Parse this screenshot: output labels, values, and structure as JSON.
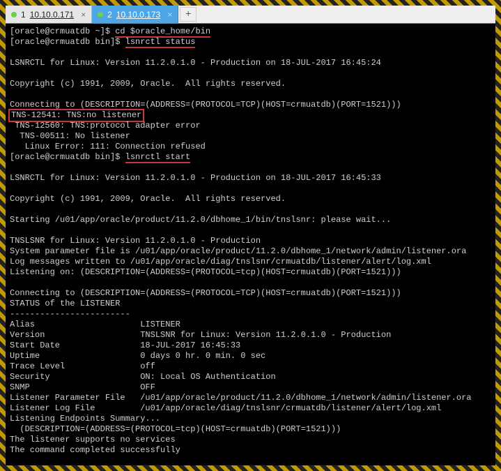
{
  "tabs": {
    "items": [
      {
        "index": "1",
        "label": "10.10.0.171",
        "close": "×"
      },
      {
        "index": "2",
        "label": "10.10.0.173",
        "close": "×"
      }
    ],
    "active": 1,
    "add": "+"
  },
  "terminal": {
    "line01_prompt": "[oracle@crmuatdb ~]$ ",
    "line01_cmd": "cd $oracle_home/bin",
    "line02_prompt": "[oracle@crmuatdb bin]$ ",
    "line02_cmd": "lsnrctl status",
    "blank": "",
    "line04": "LSNRCTL for Linux: Version 11.2.0.1.0 - Production on 18-JUL-2017 16:45:24",
    "line06": "Copyright (c) 1991, 2009, Oracle.  All rights reserved.",
    "line08": "Connecting to (DESCRIPTION=(ADDRESS=(PROTOCOL=TCP)(HOST=crmuatdb)(PORT=1521)))",
    "line09": "TNS-12541: TNS:no listener",
    "line10": " TNS-12560: TNS:protocol adapter error",
    "line11": "  TNS-00511: No listener",
    "line12": "   Linux Error: 111: Connection refused",
    "line13_prompt": "[oracle@crmuatdb bin]$ ",
    "line13_cmd": "lsnrctl start",
    "line15": "LSNRCTL for Linux: Version 11.2.0.1.0 - Production on 18-JUL-2017 16:45:33",
    "line17": "Copyright (c) 1991, 2009, Oracle.  All rights reserved.",
    "line19": "Starting /u01/app/oracle/product/11.2.0/dbhome_1/bin/tnslsnr: please wait...",
    "line21": "TNSLSNR for Linux: Version 11.2.0.1.0 - Production",
    "line22": "System parameter file is /u01/app/oracle/product/11.2.0/dbhome_1/network/admin/listener.ora",
    "line23": "Log messages written to /u01/app/oracle/diag/tnslsnr/crmuatdb/listener/alert/log.xml",
    "line24": "Listening on: (DESCRIPTION=(ADDRESS=(PROTOCOL=tcp)(HOST=crmuatdb)(PORT=1521)))",
    "line26": "Connecting to (DESCRIPTION=(ADDRESS=(PROTOCOL=TCP)(HOST=crmuatdb)(PORT=1521)))",
    "line27": "STATUS of the LISTENER",
    "line28": "------------------------",
    "line29": "Alias                     LISTENER",
    "line30": "Version                   TNSLSNR for Linux: Version 11.2.0.1.0 - Production",
    "line31": "Start Date                18-JUL-2017 16:45:33",
    "line32": "Uptime                    0 days 0 hr. 0 min. 0 sec",
    "line33": "Trace Level               off",
    "line34": "Security                  ON: Local OS Authentication",
    "line35": "SNMP                      OFF",
    "line36": "Listener Parameter File   /u01/app/oracle/product/11.2.0/dbhome_1/network/admin/listener.ora",
    "line37": "Listener Log File         /u01/app/oracle/diag/tnslsnr/crmuatdb/listener/alert/log.xml",
    "line38": "Listening Endpoints Summary...",
    "line39": "  (DESCRIPTION=(ADDRESS=(PROTOCOL=tcp)(HOST=crmuatdb)(PORT=1521)))",
    "line40": "The listener supports no services",
    "line41": "The command completed successfully"
  }
}
